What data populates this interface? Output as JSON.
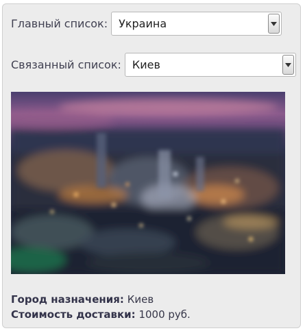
{
  "main_list": {
    "label": "Главный список:",
    "selected": "Украина"
  },
  "linked_list": {
    "label": "Связанный список:",
    "selected": "Киев"
  },
  "image": {
    "icon": "city-photo"
  },
  "info": {
    "city_label": "Город назначения:",
    "city_value": "Киев",
    "cost_label": "Стоимость доставки:",
    "cost_value": "1000 руб."
  }
}
